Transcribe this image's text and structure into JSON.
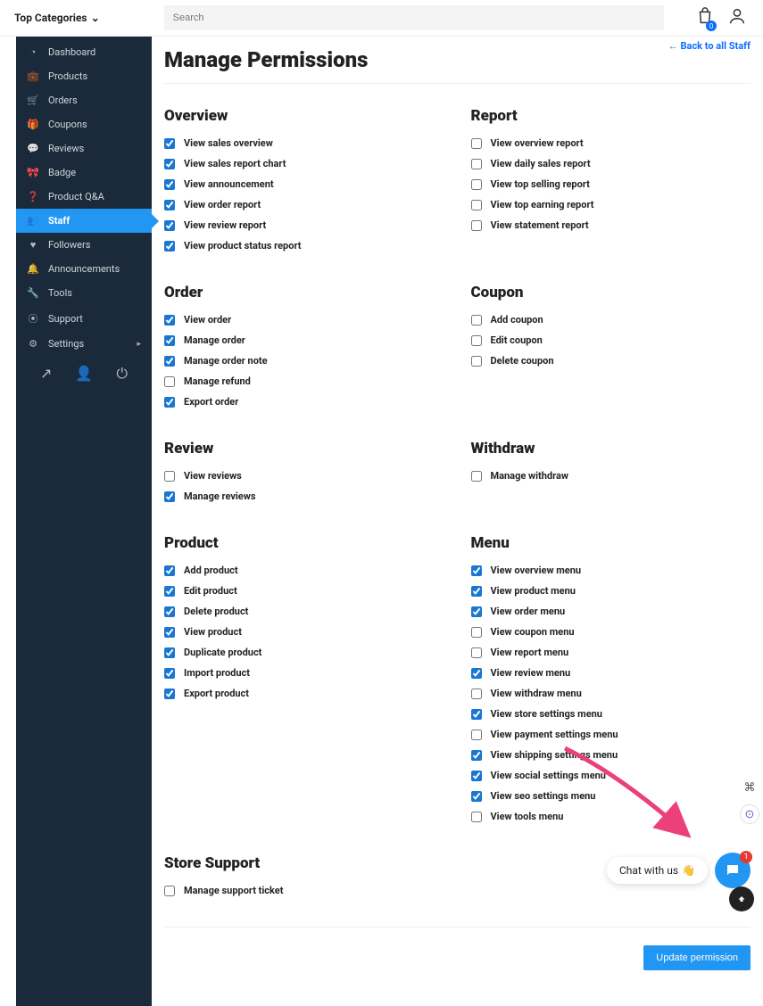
{
  "header": {
    "top_categories": "Top Categories",
    "search_placeholder": "Search",
    "bag_count": "0"
  },
  "sidebar": {
    "items": [
      {
        "label": "Dashboard",
        "icon": "gauge-icon"
      },
      {
        "label": "Products",
        "icon": "briefcase-icon"
      },
      {
        "label": "Orders",
        "icon": "cart-icon"
      },
      {
        "label": "Coupons",
        "icon": "gift-icon"
      },
      {
        "label": "Reviews",
        "icon": "chat-icon"
      },
      {
        "label": "Badge",
        "icon": "ribbon-icon"
      },
      {
        "label": "Product Q&A",
        "icon": "question-icon"
      },
      {
        "label": "Staff",
        "icon": "users-icon",
        "active": true
      },
      {
        "label": "Followers",
        "icon": "heart-icon"
      },
      {
        "label": "Announcements",
        "icon": "bell-icon"
      },
      {
        "label": "Tools",
        "icon": "wrench-icon"
      },
      {
        "label": "Support",
        "icon": "lifebuoy-icon"
      },
      {
        "label": "Settings",
        "icon": "gear-icon",
        "arrow": true
      }
    ]
  },
  "main": {
    "back_link": "← Back to all Staff",
    "title": "Manage Permissions",
    "update_button": "Update permission",
    "sections": [
      {
        "title": "Overview",
        "col": 1,
        "items": [
          {
            "label": "View sales overview",
            "checked": true
          },
          {
            "label": "View sales report chart",
            "checked": true
          },
          {
            "label": "View announcement",
            "checked": true
          },
          {
            "label": "View order report",
            "checked": true
          },
          {
            "label": "View review report",
            "checked": true
          },
          {
            "label": "View product status report",
            "checked": true
          }
        ]
      },
      {
        "title": "Report",
        "col": 2,
        "items": [
          {
            "label": "View overview report",
            "checked": false
          },
          {
            "label": "View daily sales report",
            "checked": false
          },
          {
            "label": "View top selling report",
            "checked": false
          },
          {
            "label": "View top earning report",
            "checked": false
          },
          {
            "label": "View statement report",
            "checked": false
          }
        ]
      },
      {
        "title": "Order",
        "col": 1,
        "items": [
          {
            "label": "View order",
            "checked": true
          },
          {
            "label": "Manage order",
            "checked": true
          },
          {
            "label": "Manage order note",
            "checked": true
          },
          {
            "label": "Manage refund",
            "checked": false
          },
          {
            "label": "Export order",
            "checked": true
          }
        ]
      },
      {
        "title": "Coupon",
        "col": 2,
        "items": [
          {
            "label": "Add coupon",
            "checked": false
          },
          {
            "label": "Edit coupon",
            "checked": false
          },
          {
            "label": "Delete coupon",
            "checked": false
          }
        ]
      },
      {
        "title": "Review",
        "col": 1,
        "items": [
          {
            "label": "View reviews",
            "checked": false
          },
          {
            "label": "Manage reviews",
            "checked": true
          }
        ]
      },
      {
        "title": "Withdraw",
        "col": 2,
        "items": [
          {
            "label": "Manage withdraw",
            "checked": false
          }
        ]
      },
      {
        "title": "Product",
        "col": 1,
        "items": [
          {
            "label": "Add product",
            "checked": true
          },
          {
            "label": "Edit product",
            "checked": true
          },
          {
            "label": "Delete product",
            "checked": true
          },
          {
            "label": "View product",
            "checked": true
          },
          {
            "label": "Duplicate product",
            "checked": true
          },
          {
            "label": "Import product",
            "checked": true
          },
          {
            "label": "Export product",
            "checked": true
          }
        ]
      },
      {
        "title": "Menu",
        "col": 2,
        "items": [
          {
            "label": "View overview menu",
            "checked": true
          },
          {
            "label": "View product menu",
            "checked": true
          },
          {
            "label": "View order menu",
            "checked": true
          },
          {
            "label": "View coupon menu",
            "checked": false
          },
          {
            "label": "View report menu",
            "checked": false
          },
          {
            "label": "View review menu",
            "checked": true
          },
          {
            "label": "View withdraw menu",
            "checked": false
          },
          {
            "label": "View store settings menu",
            "checked": true
          },
          {
            "label": "View payment settings menu",
            "checked": false
          },
          {
            "label": "View shipping settings menu",
            "checked": true
          },
          {
            "label": "View social settings menu",
            "checked": true
          },
          {
            "label": "View seo settings menu",
            "checked": true
          },
          {
            "label": "View tools menu",
            "checked": false
          }
        ]
      },
      {
        "title": "Store Support",
        "col": 1,
        "full": true,
        "items": [
          {
            "label": "Manage support ticket",
            "checked": false
          }
        ]
      }
    ]
  },
  "chat": {
    "text": "Chat with us",
    "emoji": "👋",
    "badge": "1"
  },
  "colors": {
    "accent": "#2196f3",
    "sidebar_bg": "#1b2a3a",
    "arrow": "#ec407a"
  }
}
